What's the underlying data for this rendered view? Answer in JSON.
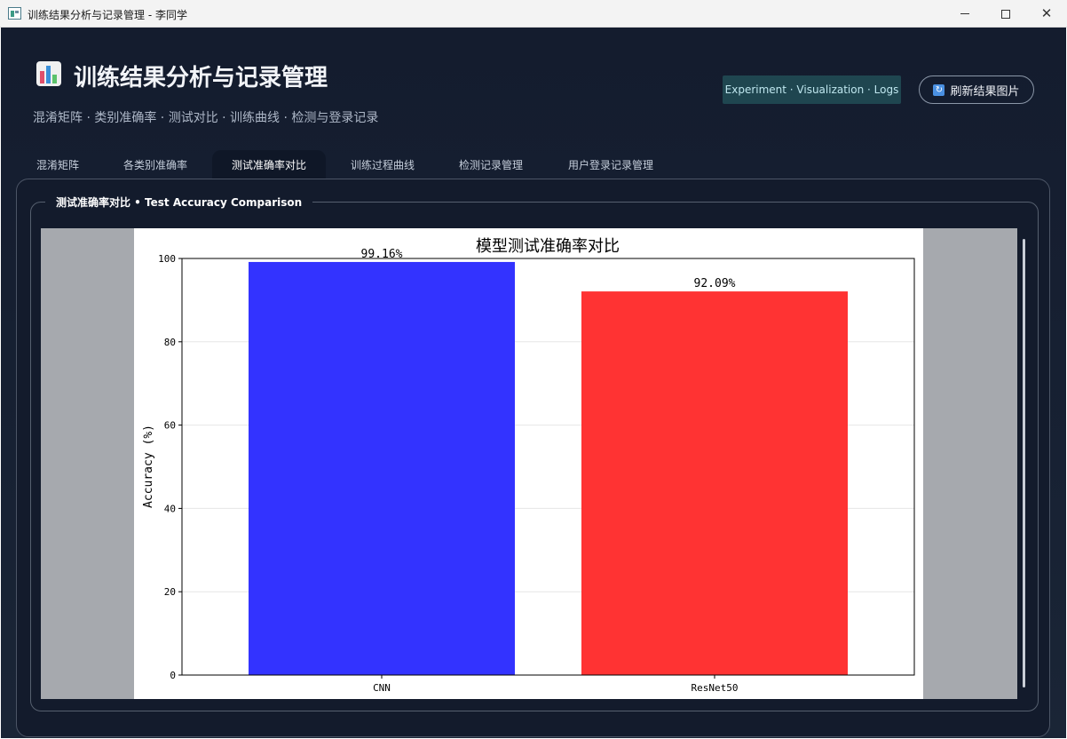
{
  "window": {
    "title": "训练结果分析与记录管理 - 李同学"
  },
  "header": {
    "title": "训练结果分析与记录管理",
    "subtitle": "混淆矩阵 · 类别准确率 · 测试对比 · 训练曲线 · 检测与登录记录",
    "chip": "Experiment · Visualization · Logs",
    "refresh_label": "刷新结果图片"
  },
  "tabs": [
    {
      "label": "混淆矩阵",
      "active": false
    },
    {
      "label": "各类别准确率",
      "active": false
    },
    {
      "label": "测试准确率对比",
      "active": true
    },
    {
      "label": "训练过程曲线",
      "active": false
    },
    {
      "label": "检测记录管理",
      "active": false
    },
    {
      "label": "用户登录记录管理",
      "active": false
    }
  ],
  "panel": {
    "group_title": "测试准确率对比 • Test Accuracy Comparison"
  },
  "chart_data": {
    "type": "bar",
    "title": "模型测试准确率对比",
    "xlabel": "",
    "ylabel": "Accuracy (%)",
    "categories": [
      "CNN",
      "ResNet50"
    ],
    "values": [
      99.16,
      92.09
    ],
    "data_labels": [
      "99.16%",
      "92.09%"
    ],
    "colors": [
      "#3333ff",
      "#ff3333"
    ],
    "ylim": [
      0,
      100
    ],
    "yticks": [
      0,
      20,
      40,
      60,
      80,
      100
    ],
    "grid": "horizontal",
    "legend": "none"
  }
}
